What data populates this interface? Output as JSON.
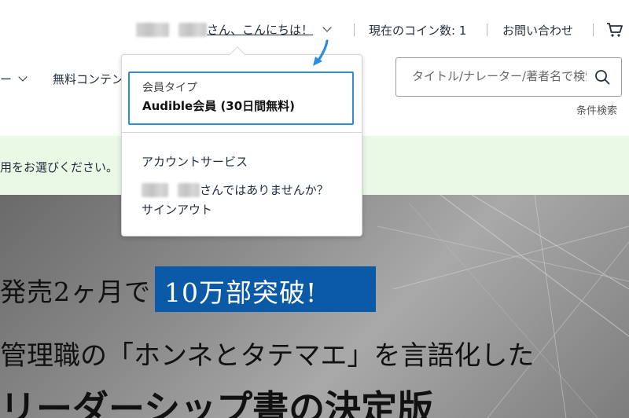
{
  "header": {
    "greeting_suffix": "さん、こんにちは！",
    "coins": "現在のコイン数: 1",
    "contact": "お問い合わせ"
  },
  "nav": {
    "item1": "ー",
    "item2": "無料コンテンツ"
  },
  "search": {
    "placeholder": "タイトル/ナレーター/著者名で検索",
    "advanced": "条件検索"
  },
  "banner": {
    "text": "用をお選びください。"
  },
  "dropdown": {
    "member_type_label": "会員タイプ",
    "member_type_value": "Audible会員 (30日間無料)",
    "account_service": "アカウントサービス",
    "not_you_suffix": "さんではありませんか？",
    "signout": "サインアウト"
  },
  "hero": {
    "line1": "発売2ヶ月で",
    "highlight": "10万部突破!",
    "line2": "管理職の「ホンネとタテマエ」を言語化した",
    "line3": "リーダーシップ書の決定版"
  },
  "colors": {
    "accent_blue": "#2f8bdc",
    "banner_green": "#e9f9e6",
    "hero_blue": "#0b5aa8",
    "text_dark": "#232f3e"
  }
}
